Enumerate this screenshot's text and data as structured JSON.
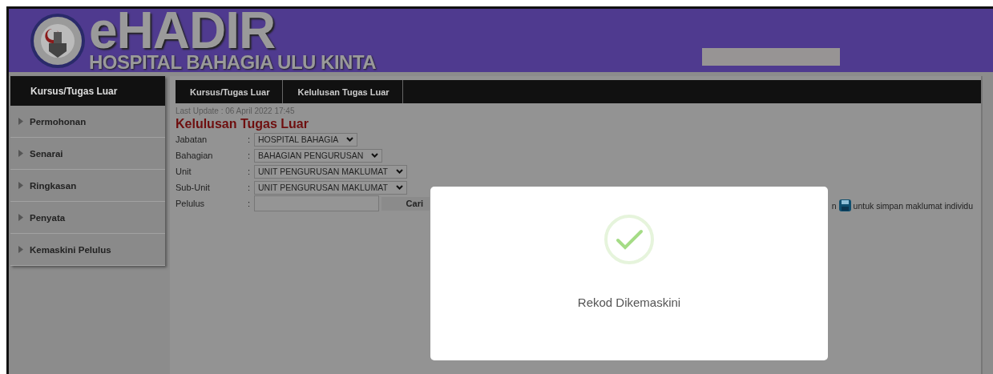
{
  "header": {
    "app_name": "eHADIR",
    "hospital_name": "HOSPITAL BAHAGIA ULU KINTA"
  },
  "sidebar": {
    "title": "Kursus/Tugas Luar",
    "items": [
      {
        "label": "Permohonan"
      },
      {
        "label": "Senarai"
      },
      {
        "label": "Ringkasan"
      },
      {
        "label": "Penyata"
      },
      {
        "label": "Kemaskini Pelulus"
      }
    ]
  },
  "breadcrumb": [
    "Kursus/Tugas Luar",
    "Kelulusan Tugas Luar"
  ],
  "last_update": "Last Update : 06 April 2022 17:45",
  "page_title": "Kelulusan Tugas Luar",
  "form": {
    "fields": [
      {
        "label": "Jabatan",
        "kind": "select",
        "value": "HOSPITAL BAHAGIA"
      },
      {
        "label": "Bahagian",
        "kind": "select",
        "value": "BAHAGIAN PENGURUSAN"
      },
      {
        "label": "Unit",
        "kind": "select",
        "value": "UNIT PENGURUSAN MAKLUMAT"
      },
      {
        "label": "Sub-Unit",
        "kind": "select",
        "value": "UNIT PENGURUSAN MAKLUMAT"
      },
      {
        "label": "Pelulus",
        "kind": "search",
        "button": "Cari"
      }
    ],
    "separator": ":"
  },
  "hint": {
    "prefix": "n",
    "suffix": "untuk simpan maklumat individu"
  },
  "modal": {
    "message": "Rekod Dikemaskini"
  }
}
